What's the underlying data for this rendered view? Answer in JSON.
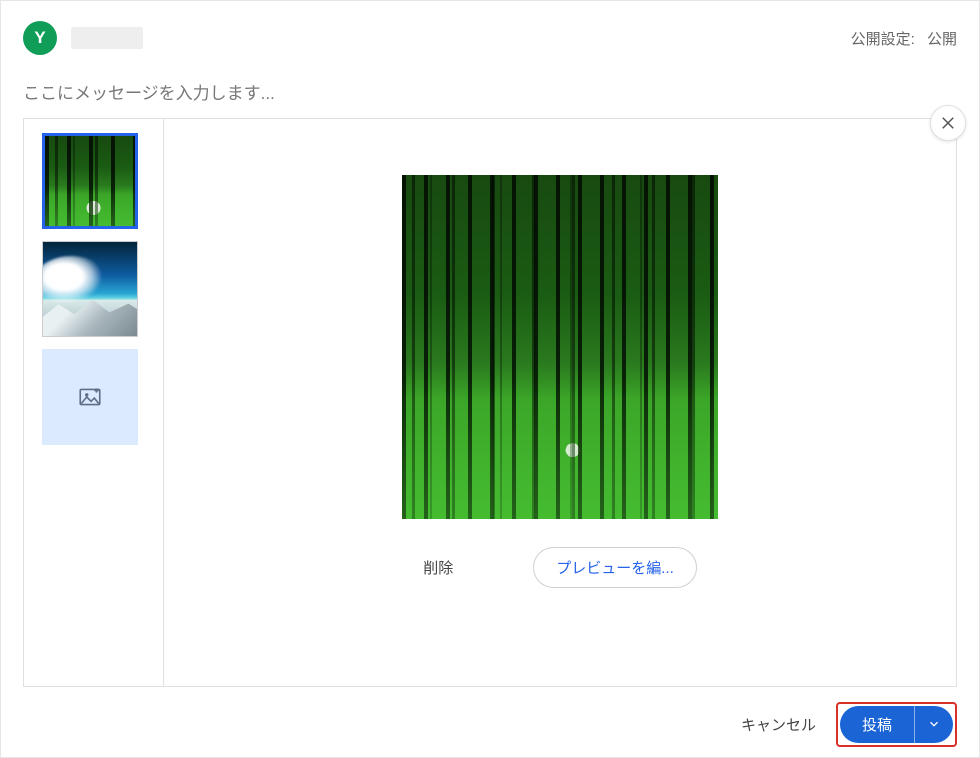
{
  "header": {
    "avatar_initial": "Y",
    "privacy_label": "公開設定:",
    "privacy_value": "公開"
  },
  "composer": {
    "placeholder": "ここにメッセージを入力します..."
  },
  "preview": {
    "delete_label": "削除",
    "edit_preview_label": "プレビューを編..."
  },
  "footer": {
    "cancel_label": "キャンセル",
    "post_label": "投稿"
  },
  "icons": {
    "close": "close-icon",
    "add_image": "add-image-icon",
    "chevron_down": "chevron-down-icon"
  }
}
